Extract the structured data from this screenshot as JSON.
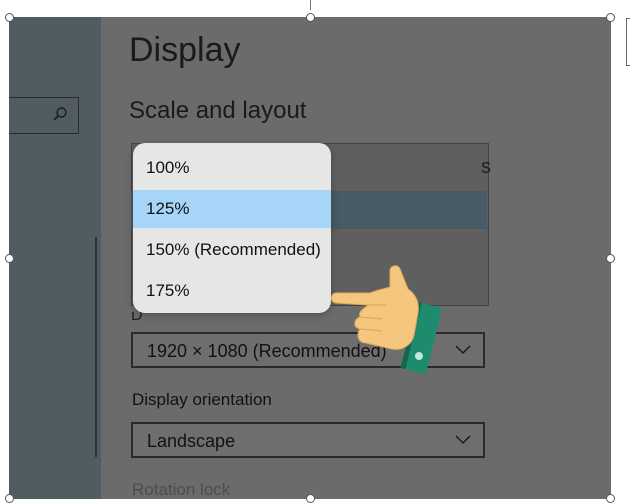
{
  "page": {
    "title": "Display",
    "section_title": "Scale and layout",
    "background_text_fragment": "s",
    "peek_label": "D"
  },
  "scale_dropdown": {
    "options": [
      "100%",
      "125%",
      "150% (Recommended)",
      "175%"
    ],
    "selected": "125%"
  },
  "resolution": {
    "value": "1920 × 1080 (Recommended)"
  },
  "orientation": {
    "label": "Display orientation",
    "value": "Landscape"
  },
  "rotation_lock": {
    "label": "Rotation lock"
  },
  "icons": {
    "search": "search-icon",
    "chevron": "chevron-down-icon",
    "pointer": "pointing-hand-icon"
  },
  "colors": {
    "overlay": "#6b6b6b",
    "selected_option": "#a6d5f8",
    "popup_bg": "#e6e6e6",
    "hand_skin": "#f5c77e",
    "cuff": "#1e8a6e"
  }
}
